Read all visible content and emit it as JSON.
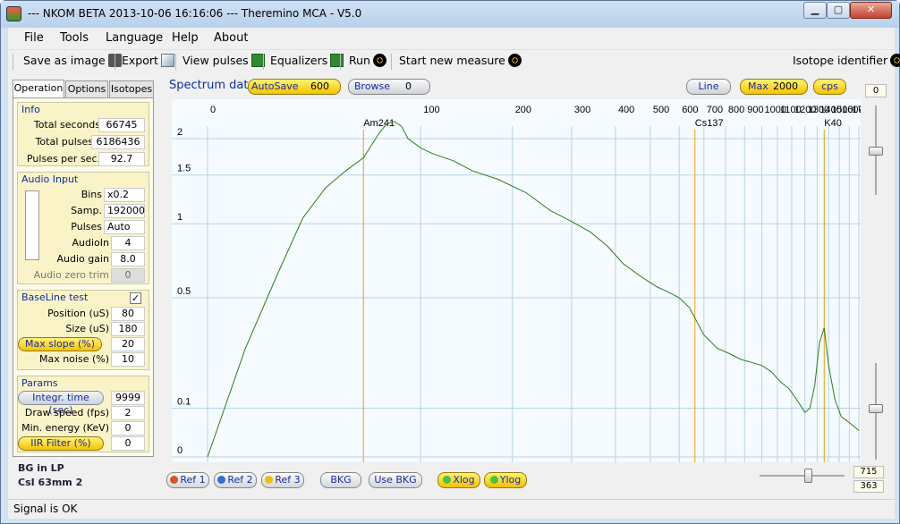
{
  "window": {
    "title": "--- NKOM BETA 2013-10-06  16:16:06 --- Theremino MCA - V5.0",
    "minimize_glyph": "▁",
    "maximize_glyph": "▢",
    "close_glyph": "✕"
  },
  "menu": [
    "File",
    "Tools",
    "Language",
    "Help",
    "About"
  ],
  "toolbar": {
    "save_as_image": "Save as image",
    "export": "Export",
    "view_pulses": "View pulses",
    "equalizers": "Equalizers",
    "run": "Run",
    "start_new_measure": "Start new measure",
    "isotope_identifier": "Isotope identifier"
  },
  "tabs": [
    "Operation",
    "Options",
    "Isotopes"
  ],
  "info": {
    "title": "Info",
    "rows": [
      {
        "label": "Total seconds",
        "value": "66745"
      },
      {
        "label": "Total pulses",
        "value": "6186436"
      },
      {
        "label": "Pulses per sec.",
        "value": "92.7"
      }
    ]
  },
  "audio_input": {
    "title": "Audio Input",
    "rows": [
      {
        "label": "Bins",
        "value": "x0.2"
      },
      {
        "label": "Samp.",
        "value": "192000"
      },
      {
        "label": "Pulses",
        "value": "Auto"
      },
      {
        "label": "AudioIn",
        "value": "4"
      },
      {
        "label": "Audio gain",
        "value": "8.0"
      },
      {
        "label": "Audio zero trim",
        "value": "0"
      }
    ]
  },
  "baseline": {
    "title": "BaseLine test",
    "checked": true,
    "check_glyph": "✓",
    "rows": [
      {
        "label": "Position (uS)",
        "value": "80"
      },
      {
        "label": "Size (uS)",
        "value": "180"
      },
      {
        "label": "Max slope (%)",
        "value": "20"
      },
      {
        "label": "Max noise (%)",
        "value": "10"
      }
    ]
  },
  "params": {
    "title": "Params",
    "rows": [
      {
        "label": "Integr. time (sec)",
        "value": "9999"
      },
      {
        "label": "Draw speed (fps)",
        "value": "2"
      },
      {
        "label": "Min. energy (KeV)",
        "value": "0"
      },
      {
        "label": "IIR Filter (%)",
        "value": "0"
      }
    ]
  },
  "detector": {
    "line1": "BG in LP",
    "line2": "CsI 63mm 2"
  },
  "status": "Signal is OK",
  "spectrum_bar": {
    "label": "Spectrum data",
    "autosave_label": "AutoSave",
    "autosave_value": "600",
    "browse_label": "Browse",
    "browse_value": "0",
    "line_label": "Line",
    "max_label": "Max",
    "max_value": "2000",
    "cps_label": "cps"
  },
  "right_column": {
    "top_value": "0",
    "value_a": "715",
    "value_b": "363"
  },
  "bottom_buttons": {
    "ref1": "Ref 1",
    "ref2": "Ref 2",
    "ref3": "Ref 3",
    "bkg": "BKG",
    "use_bkg": "Use BKG",
    "xlog": "Xlog",
    "ylog": "Ylog"
  },
  "colors": {
    "chart_bg": "#f5fbfe",
    "grid": "#b7d3e6",
    "curve": "#2e7d15",
    "marker": "#f0a000",
    "title_text": "#0d2ea0"
  },
  "chart_data": {
    "type": "line",
    "x_scale": "log",
    "y_scale": "log",
    "x_ticks": [
      0,
      100,
      200,
      300,
      400,
      500,
      600,
      700,
      800,
      900,
      1000,
      1100,
      1200,
      1300,
      1400,
      1500,
      1600,
      1700,
      1800
    ],
    "y_ticks": [
      0,
      0.1,
      0.5,
      1,
      1.5,
      2
    ],
    "xlim": [
      0,
      1800
    ],
    "ylim": [
      0,
      2
    ],
    "markers": [
      {
        "name": "Am241",
        "x": 60
      },
      {
        "name": "Cs137",
        "x": 662
      },
      {
        "name": "K40",
        "x": 1461
      }
    ],
    "series": [
      {
        "x": [
          0,
          10,
          20,
          30,
          40,
          50,
          60,
          70,
          75,
          80,
          85,
          90,
          100,
          110,
          130,
          150,
          180,
          220,
          260,
          300,
          340,
          380,
          420,
          470,
          520,
          560,
          600,
          640,
          700,
          760,
          820,
          880,
          940,
          1000,
          1060,
          1120,
          1180,
          1240,
          1300,
          1340,
          1380,
          1420,
          1460,
          1500,
          1560,
          1620,
          1680,
          1740,
          1800
        ],
        "y": [
          0,
          0.28,
          0.62,
          1.05,
          1.35,
          1.55,
          1.72,
          2.1,
          2.25,
          2.28,
          2.2,
          2.0,
          1.86,
          1.78,
          1.68,
          1.55,
          1.45,
          1.3,
          1.12,
          1.02,
          0.93,
          0.82,
          0.7,
          0.62,
          0.56,
          0.53,
          0.5,
          0.45,
          0.33,
          0.28,
          0.26,
          0.24,
          0.23,
          0.22,
          0.2,
          0.17,
          0.15,
          0.12,
          0.09,
          0.1,
          0.16,
          0.3,
          0.36,
          0.22,
          0.12,
          0.08,
          0.07,
          0.06,
          0.05
        ]
      }
    ]
  }
}
